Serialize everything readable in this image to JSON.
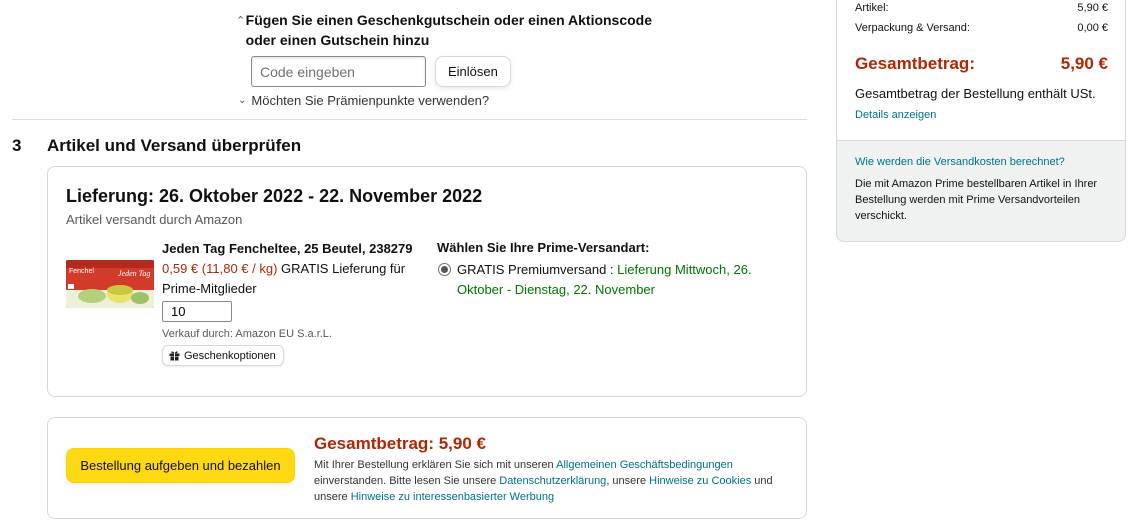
{
  "gift": {
    "title": "Fügen Sie einen Geschenkgutschein oder einen Aktionscode oder einen Gutschein hinzu",
    "code_placeholder": "Code eingeben",
    "redeem_label": "Einlösen",
    "points_label": "Möchten Sie Prämienpunkte verwenden?"
  },
  "section": {
    "number": "3",
    "title": "Artikel und Versand überprüfen"
  },
  "shipment": {
    "delivery_title": "Lieferung: 26. Oktober 2022 - 22. November 2022",
    "shipped_by": "Artikel versandt durch Amazon",
    "product": {
      "name": "Jeden Tag Fencheltee, 25 Beutel, 238279",
      "price": "0,59 €",
      "unit_price": "(11,80 € / kg)",
      "shipping_note": "GRATIS Lieferung für Prime-Mitglieder",
      "quantity": "10",
      "sold_by": "Verkauf durch: Amazon EU S.a.r.L.",
      "gift_options_label": "Geschenkoptionen",
      "image_brand": "Jeden Tag",
      "image_label": "Fenchel"
    },
    "prime": {
      "title": "Wählen Sie Ihre Prime-Versandart:",
      "option_label": "GRATIS Premiumversand :",
      "option_dates": "Lieferung Mittwoch, 26. Oktober - Dienstag, 22. November"
    }
  },
  "order": {
    "button_label": "Bestellung aufgeben und bezahlen",
    "total_label": "Gesamtbetrag:",
    "total_value": "5,90 €",
    "legal_1": "Mit Ihrer Bestellung erklären Sie sich mit unseren",
    "link_agb": "Allgemeinen Geschäftsbedingungen",
    "legal_2": "einverstanden. Bitte lesen Sie unsere",
    "link_privacy": "Datenschutzerklärung",
    "legal_3": ", unsere",
    "link_cookies": "Hinweise zu Cookies",
    "legal_4": "und unsere",
    "link_ads": "Hinweise zu interessenbasierter Werbung"
  },
  "summary": {
    "items_label": "Artikel:",
    "items_value": "5,90 €",
    "shipping_label": "Verpackung & Versand:",
    "shipping_value": "0,00 €",
    "total_label": "Gesamtbetrag:",
    "total_value": "5,90 €",
    "vat_text": "Gesamtbetrag der Bestellung enthält USt.",
    "vat_link": "Details anzeigen",
    "info_link": "Wie werden die Versandkosten berechnet?",
    "info_text": "Die mit Amazon Prime bestellbaren Artikel in Ihrer Bestellung werden mit Prime Versandvorteilen verschickt."
  },
  "colors": {
    "price_red": "#b12704",
    "link_teal": "#007185",
    "delivery_green": "#007600",
    "button_yellow": "#ffd814"
  },
  "icons": {
    "gift_block_toggle": "chevron-up-icon",
    "points_toggle": "chevron-down-icon",
    "gift_options": "gift-icon"
  }
}
